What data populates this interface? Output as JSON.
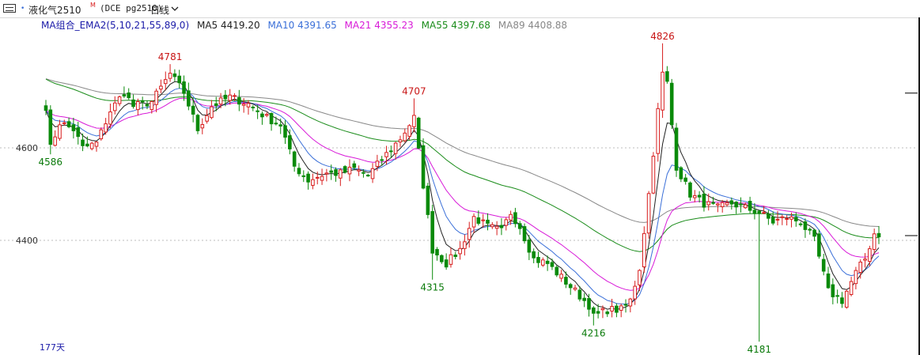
{
  "header": {
    "dot": "•",
    "symbol": "液化气2510",
    "badge": "M",
    "code": "(DCE pg2510)",
    "period": "日线",
    "chevron_icon": "chevron-down-icon",
    "menu_icon": "menu-icon"
  },
  "legend": {
    "group": "MA组合_EMA2(5,10,21,55,89,0)",
    "ma5": "MA5 4419.20",
    "ma10": "MA10 4391.65",
    "ma21": "MA21 4355.23",
    "ma55": "MA55 4397.68",
    "ma89": "MA89 4408.88",
    "colors": {
      "group": "#1a1aa8",
      "ma5": "#222222",
      "ma10": "#3a6fd8",
      "ma21": "#d81ad8",
      "ma55": "#1a8c1a",
      "ma89": "#888888"
    }
  },
  "footer": {
    "days": "177天"
  },
  "chart_data": {
    "type": "candlestick",
    "y_ticks": [
      "4600",
      "4400"
    ],
    "ylim": [
      4180,
      4832
    ],
    "grid": "dotted horizontal lines at 4600 and 4400",
    "colors": {
      "up": "#d81e1e",
      "down": "#0a8a0a",
      "background": "#ffffff"
    },
    "annotations": [
      {
        "text": "4586",
        "index": 1,
        "value": 4586,
        "kind": "low"
      },
      {
        "text": "4781",
        "index": 27,
        "value": 4781,
        "kind": "high"
      },
      {
        "text": "4707",
        "index": 80,
        "value": 4707,
        "kind": "high"
      },
      {
        "text": "4315",
        "index": 84,
        "value": 4315,
        "kind": "low"
      },
      {
        "text": "4216",
        "index": 119,
        "value": 4216,
        "kind": "low"
      },
      {
        "text": "4826",
        "index": 134,
        "value": 4826,
        "kind": "high"
      },
      {
        "text": "4181",
        "index": 155,
        "value": 4181,
        "kind": "low"
      }
    ],
    "anchors": [
      [
        0,
        4690
      ],
      [
        1,
        4600
      ],
      [
        3,
        4655
      ],
      [
        6,
        4640
      ],
      [
        8,
        4600
      ],
      [
        11,
        4610
      ],
      [
        14,
        4680
      ],
      [
        17,
        4720
      ],
      [
        19,
        4690
      ],
      [
        23,
        4700
      ],
      [
        27,
        4760
      ],
      [
        30,
        4720
      ],
      [
        33,
        4640
      ],
      [
        36,
        4690
      ],
      [
        40,
        4710
      ],
      [
        44,
        4695
      ],
      [
        48,
        4665
      ],
      [
        51,
        4650
      ],
      [
        54,
        4560
      ],
      [
        57,
        4530
      ],
      [
        61,
        4545
      ],
      [
        64,
        4545
      ],
      [
        67,
        4555
      ],
      [
        70,
        4540
      ],
      [
        73,
        4575
      ],
      [
        77,
        4620
      ],
      [
        80,
        4665
      ],
      [
        82,
        4520
      ],
      [
        84,
        4380
      ],
      [
        87,
        4350
      ],
      [
        90,
        4380
      ],
      [
        93,
        4450
      ],
      [
        96,
        4430
      ],
      [
        99,
        4420
      ],
      [
        101,
        4460
      ],
      [
        103,
        4430
      ],
      [
        106,
        4360
      ],
      [
        109,
        4350
      ],
      [
        112,
        4320
      ],
      [
        115,
        4290
      ],
      [
        118,
        4260
      ],
      [
        119,
        4235
      ],
      [
        122,
        4250
      ],
      [
        125,
        4250
      ],
      [
        127,
        4270
      ],
      [
        129,
        4340
      ],
      [
        131,
        4500
      ],
      [
        133,
        4680
      ],
      [
        134,
        4760
      ],
      [
        135,
        4740
      ],
      [
        137,
        4560
      ],
      [
        140,
        4500
      ],
      [
        143,
        4480
      ],
      [
        146,
        4470
      ],
      [
        149,
        4480
      ],
      [
        152,
        4470
      ],
      [
        155,
        4460
      ],
      [
        158,
        4440
      ],
      [
        161,
        4450
      ],
      [
        164,
        4440
      ],
      [
        167,
        4400
      ],
      [
        170,
        4290
      ],
      [
        173,
        4270
      ],
      [
        176,
        4330
      ],
      [
        178,
        4360
      ],
      [
        180,
        4415
      ]
    ]
  }
}
